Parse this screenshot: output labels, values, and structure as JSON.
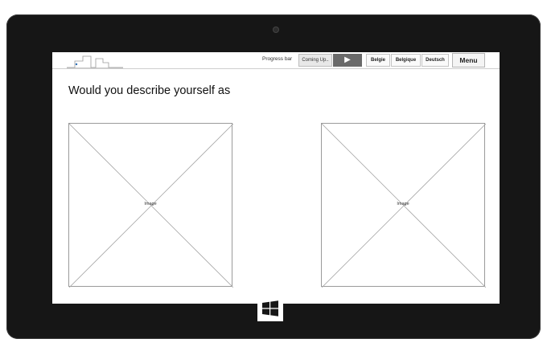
{
  "topbar": {
    "progress_label": "Progress bar",
    "coming_up_label": "Coming Up..",
    "play_symbol": "▶",
    "languages": [
      "Belgie",
      "Belgique",
      "Deutsch"
    ],
    "menu_label": "Menu"
  },
  "main": {
    "question": "Would you describe yourself as",
    "image_placeholders": [
      {
        "label": "Image"
      },
      {
        "label": "Image"
      }
    ]
  },
  "colors": {
    "bezel": "#161616",
    "play_button": "#6a6a6a",
    "placeholder_border": "#9a9a9a"
  },
  "icons": [
    "logo-skyline-icon",
    "play-icon",
    "windows-start-icon",
    "front-camera-icon"
  ]
}
